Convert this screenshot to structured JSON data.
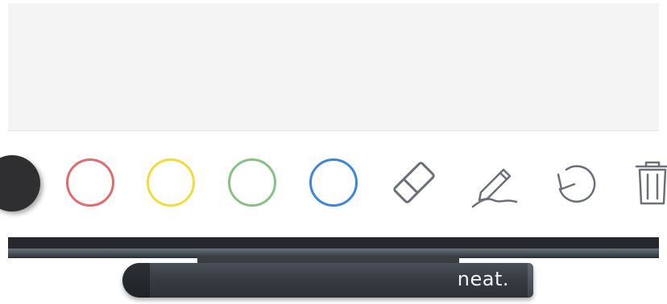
{
  "toolbar": {
    "tools": [
      {
        "name": "black-swatch",
        "color": "#2f2f31"
      },
      {
        "name": "red-swatch",
        "color": "#e36a6d"
      },
      {
        "name": "yellow-swatch",
        "color": "#f2dc3a"
      },
      {
        "name": "green-swatch",
        "color": "#86c283"
      },
      {
        "name": "blue-swatch",
        "color": "#3d86d8"
      },
      {
        "name": "eraser-icon"
      },
      {
        "name": "pen-icon"
      },
      {
        "name": "undo-icon"
      },
      {
        "name": "trash-icon"
      }
    ],
    "icon_color": "#6b6f79"
  },
  "pen": {
    "brand": "neat."
  }
}
